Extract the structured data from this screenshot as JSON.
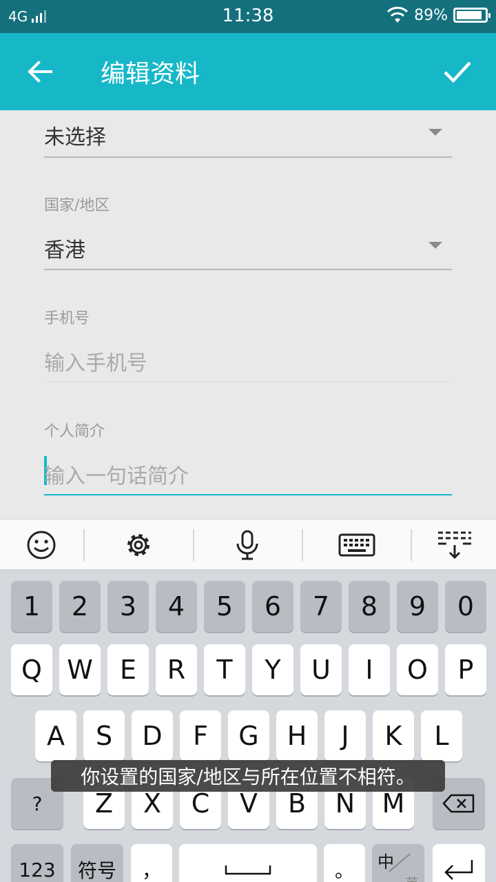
{
  "status_bar": {
    "network": "4G",
    "time": "11:38",
    "battery": "89%",
    "battery_level": 0.89
  },
  "app_bar": {
    "title": "编辑资料"
  },
  "form": {
    "gender": {
      "value": "未选择"
    },
    "country": {
      "label": "国家/地区",
      "value": "香港"
    },
    "phone": {
      "label": "手机号",
      "placeholder": "输入手机号"
    },
    "bio": {
      "label": "个人简介",
      "placeholder": "输入一句话简介"
    }
  },
  "keyboard": {
    "row_numbers": [
      "1",
      "2",
      "3",
      "4",
      "5",
      "6",
      "7",
      "8",
      "9",
      "0"
    ],
    "row_top": [
      "Q",
      "W",
      "E",
      "R",
      "T",
      "Y",
      "U",
      "I",
      "O",
      "P"
    ],
    "row_mid": [
      "A",
      "S",
      "D",
      "F",
      "G",
      "H",
      "J",
      "K",
      "L"
    ],
    "row_bottom": [
      "Z",
      "X",
      "C",
      "V",
      "B",
      "N",
      "M"
    ],
    "shift_label": "?",
    "num_label": "123",
    "symbol_label": "符号",
    "comma_label": "，",
    "period_label": "。",
    "lang_top": "中",
    "lang_bottom": "英"
  },
  "toast": {
    "message": "你设置的国家/地区与所在位置不相符。"
  },
  "colors": {
    "accent": "#16b8c8",
    "status_bar": "#14707d"
  }
}
